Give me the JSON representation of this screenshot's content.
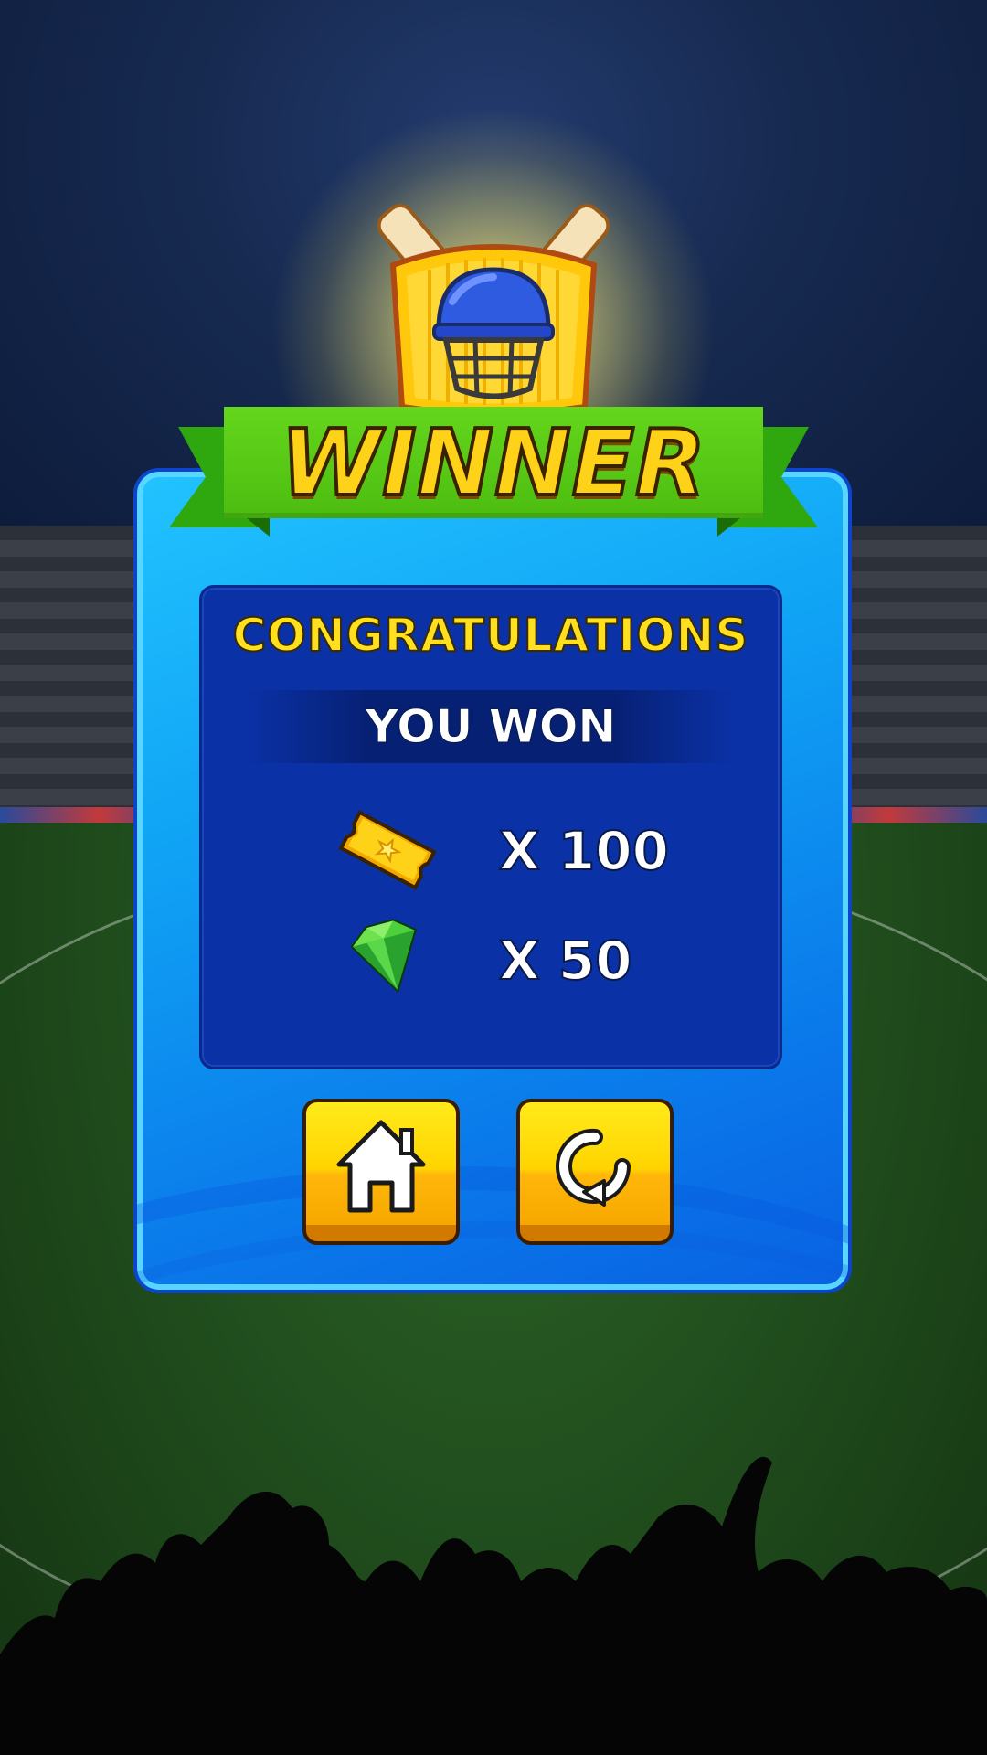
{
  "banner": {
    "title": "WINNER",
    "emblem_icon": "cricket-helmet-bats-icon"
  },
  "panel": {
    "congrats": "CONGRATULATIONS",
    "subtitle": "YOU WON",
    "rewards": [
      {
        "icon": "ticket-icon",
        "label": "X 100"
      },
      {
        "icon": "emerald-gem-icon",
        "label": "X 50"
      }
    ]
  },
  "buttons": [
    {
      "icon": "home-icon",
      "action": "home"
    },
    {
      "icon": "replay-icon",
      "action": "replay"
    }
  ],
  "colors": {
    "panel": "#10a4f5",
    "inner_panel": "#0a31a6",
    "ribbon": "#4cbd10",
    "title": "#ffd21a",
    "button": "#ffd400"
  }
}
